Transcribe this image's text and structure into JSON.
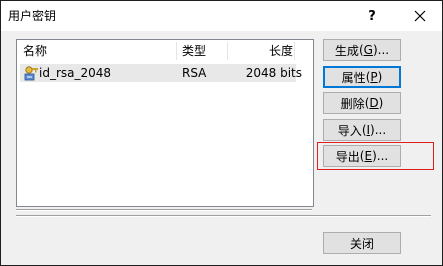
{
  "window": {
    "title": "用户密钥",
    "help_label": "?",
    "close_icon": "close-icon"
  },
  "list": {
    "columns": [
      "名称",
      "类型",
      "长度"
    ],
    "rows": [
      {
        "icon": "key-icon",
        "name": "id_rsa_2048",
        "type": "RSA",
        "length": "2048 bits"
      }
    ]
  },
  "buttons": {
    "generate": {
      "text": "生成",
      "mnemonic": "G",
      "suffix": "..."
    },
    "properties": {
      "text": "属性",
      "mnemonic": "P",
      "suffix": ""
    },
    "delete": {
      "text": "删除",
      "mnemonic": "D",
      "suffix": ""
    },
    "import": {
      "text": "导入",
      "mnemonic": "I",
      "suffix": "..."
    },
    "export": {
      "text": "导出",
      "mnemonic": "E",
      "suffix": "..."
    },
    "close": {
      "text": "关闭"
    }
  },
  "colors": {
    "focus_border": "#0078d7",
    "highlight_border": "#e02020",
    "selected_row": "#e8e8e8"
  }
}
